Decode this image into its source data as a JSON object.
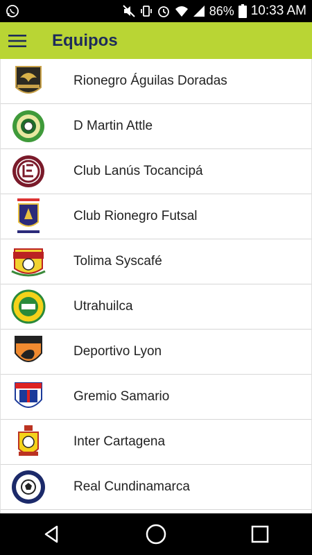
{
  "status_bar": {
    "battery": "86%",
    "time": "10:33 AM",
    "icons": [
      "whatsapp-icon",
      "mute-icon",
      "vibrate-icon",
      "alarm-icon",
      "wifi-icon",
      "signal-icon",
      "battery-icon"
    ]
  },
  "app_bar": {
    "title": "Equipos",
    "color": "#b9d534",
    "title_color": "#1d2b5a"
  },
  "teams": [
    {
      "name": "Rionegro Águilas Doradas",
      "logo": "aguilas-doradas-logo"
    },
    {
      "name": "D Martin Attle",
      "logo": "d-martin-attle-logo"
    },
    {
      "name": "Club Lanús Tocancipá",
      "logo": "lanus-logo"
    },
    {
      "name": "Club Rionegro Futsal",
      "logo": "rionegro-futsal-logo"
    },
    {
      "name": "Tolima Syscafé",
      "logo": "tolima-logo"
    },
    {
      "name": "Utrahuilca",
      "logo": "utrahuilca-logo"
    },
    {
      "name": "Deportivo Lyon",
      "logo": "deportivo-lyon-logo"
    },
    {
      "name": "Gremio Samario",
      "logo": "gremio-samario-logo"
    },
    {
      "name": "Inter Cartagena",
      "logo": "inter-cartagena-logo"
    },
    {
      "name": "Real Cundinamarca",
      "logo": "real-cundinamarca-logo"
    }
  ],
  "nav_bar": {
    "buttons": [
      "back-icon",
      "home-icon",
      "recents-icon"
    ]
  }
}
